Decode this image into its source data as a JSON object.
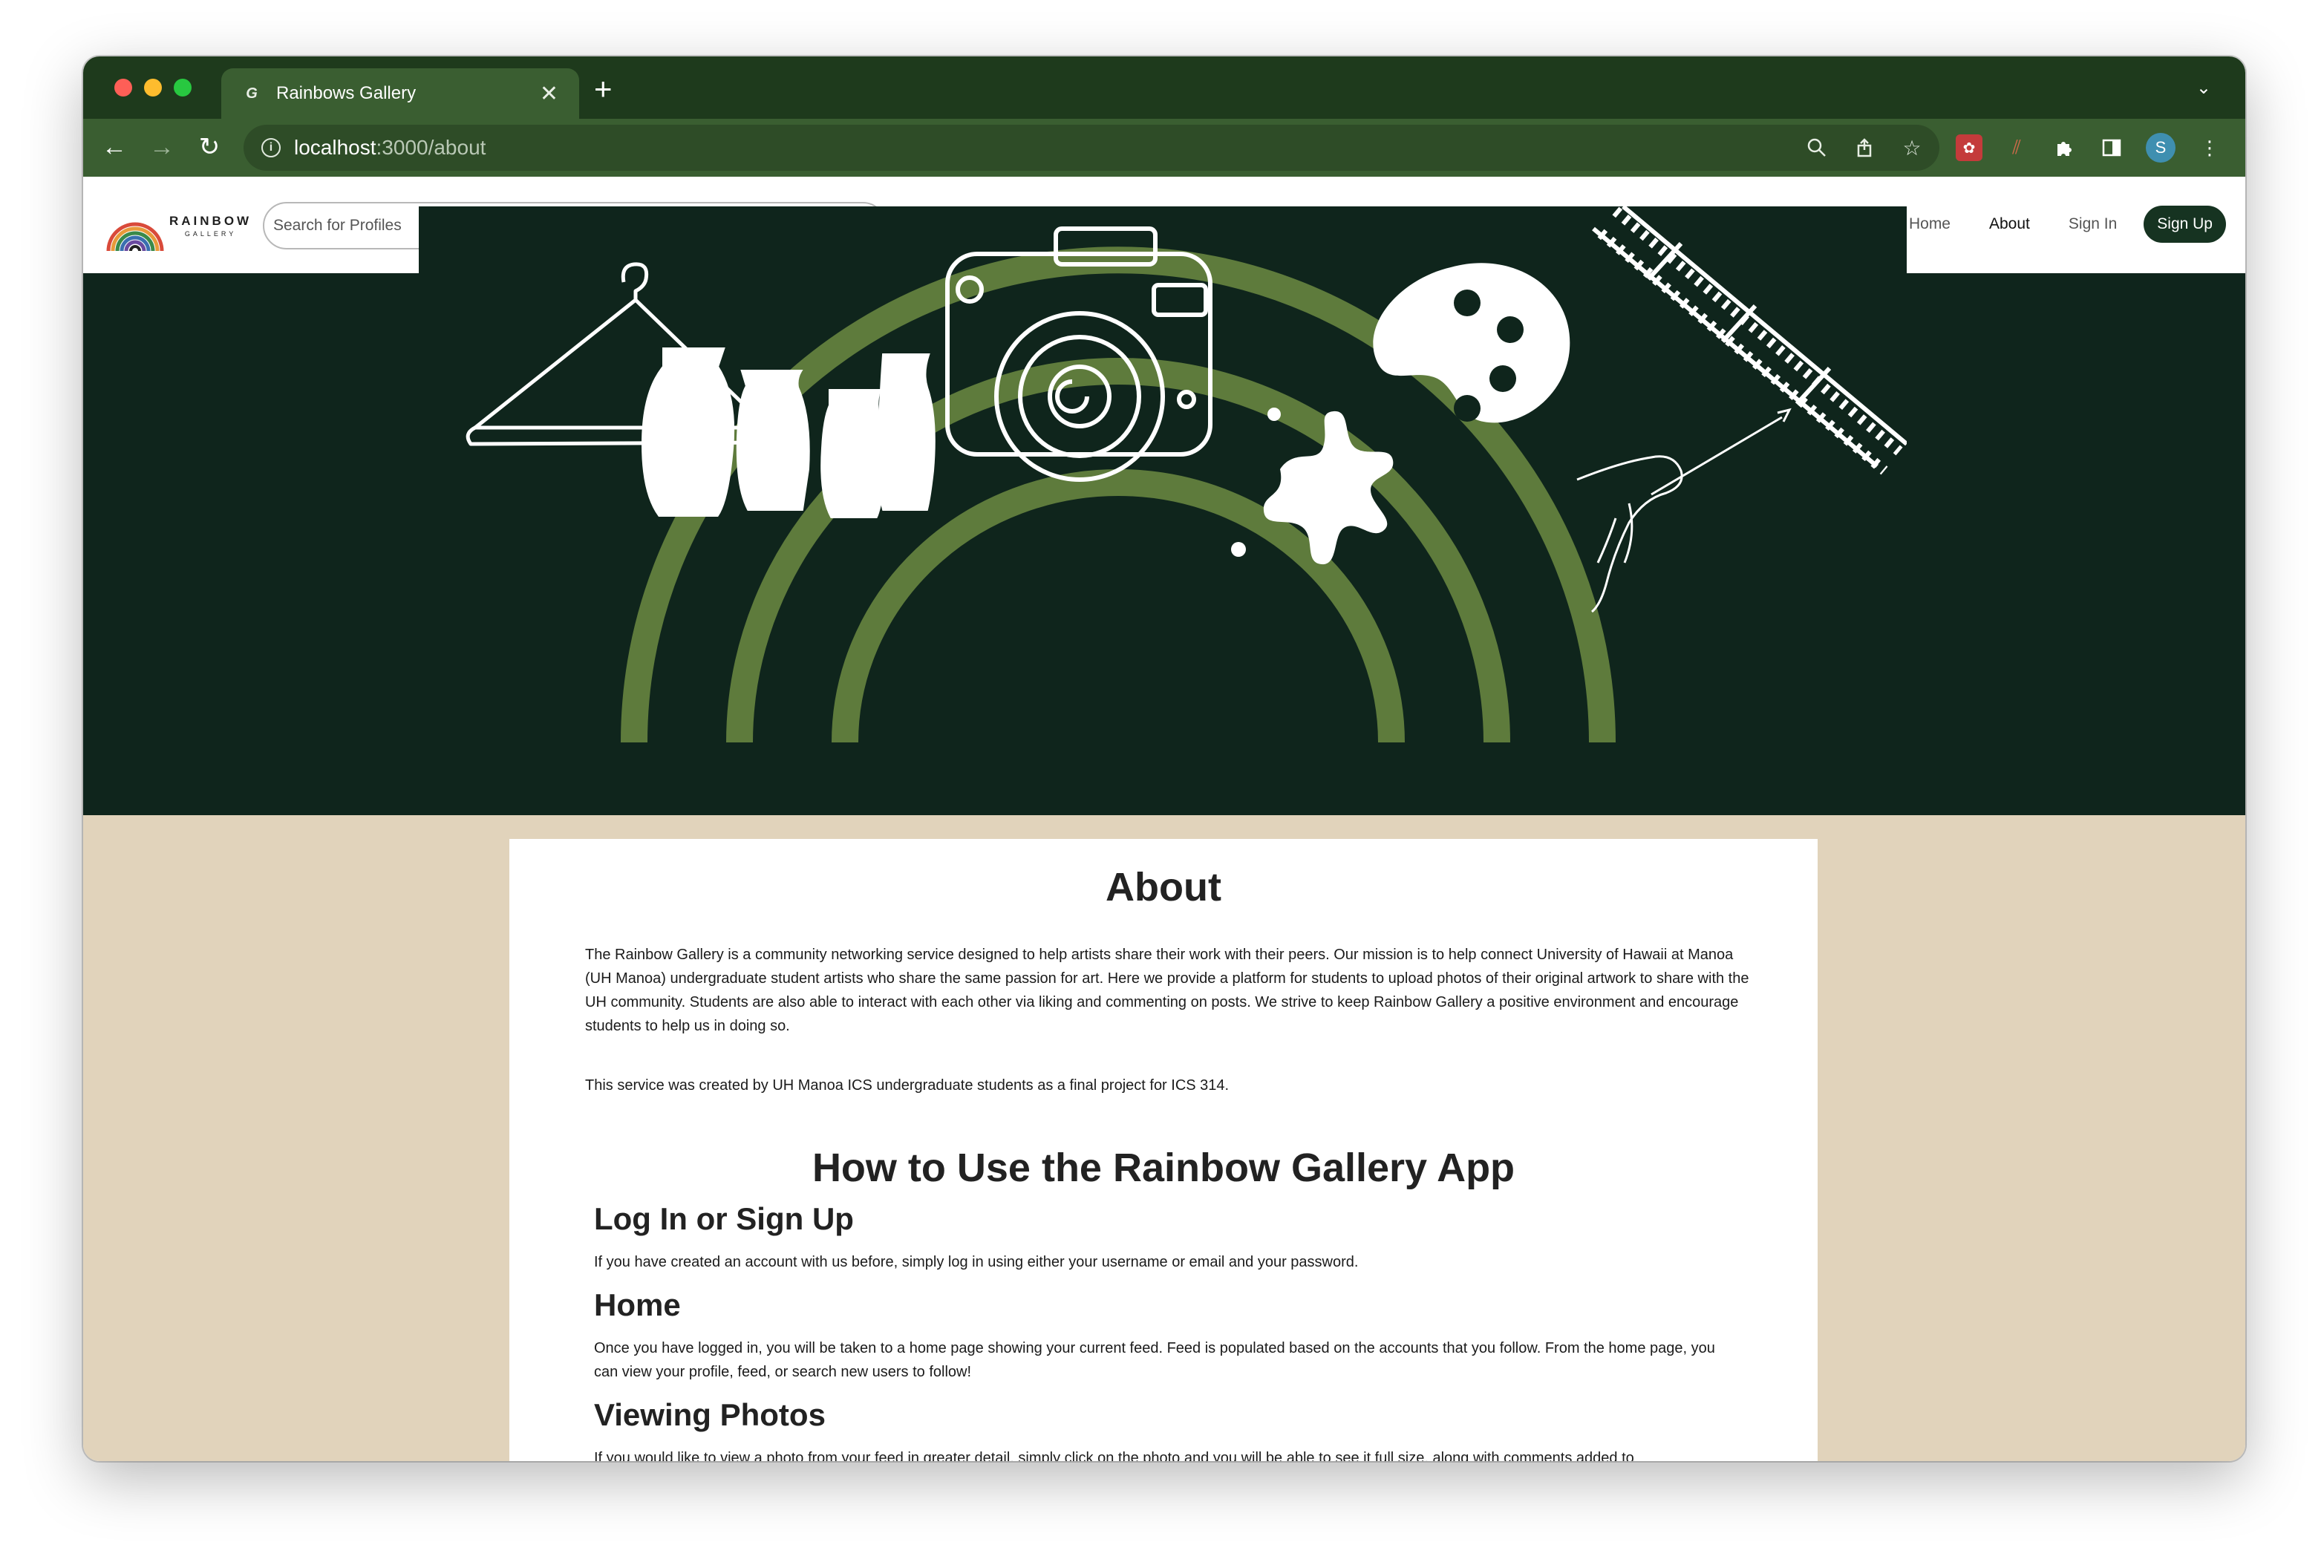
{
  "browser": {
    "tab_title": "Rainbows Gallery",
    "url_host": "localhost",
    "url_path": ":3000/about",
    "profile_initial": "S",
    "accent": "#3a5e31",
    "tabbar_color": "#1e3a1c"
  },
  "site": {
    "logo_main": "RAINBOW",
    "logo_sub": "GALLERY",
    "search_placeholder": "Search for Profiles",
    "nav": {
      "home": "Home",
      "about": "About",
      "sign_in": "Sign In",
      "sign_up": "Sign Up"
    },
    "hero_bg": "#0f251c",
    "rainbow_color": "#5e7b3c",
    "page_bg": "#e1d3bb"
  },
  "about": {
    "title": "About",
    "paragraph1": "The Rainbow Gallery is a community networking service designed to help artists share their work with their peers. Our mission is to help connect University of Hawaii at Manoa (UH Manoa) undergraduate student artists who share the same passion for art. Here we provide a platform for students to upload photos of their original artwork to share with the UH community. Students are also able to interact with each other via liking and commenting on posts. We strive to keep Rainbow Gallery a positive environment and encourage students to help us in doing so.",
    "paragraph2": "This service was created by UH Manoa ICS undergraduate students as a final project for ICS 314."
  },
  "howto": {
    "title": "How to Use the Rainbow Gallery App",
    "sections": [
      {
        "heading": "Log In or Sign Up",
        "text": "If you have created an account with us before, simply log in using either your username or email and your password."
      },
      {
        "heading": "Home",
        "text": "Once you have logged in, you will be taken to a home page showing your current feed. Feed is populated based on the accounts that you follow. From the home page, you can view your profile, feed, or search new users to follow!"
      },
      {
        "heading": "Viewing Photos",
        "text": "If you would like to view a photo from your feed in greater detail, simply click on the photo and you will be able to see it full size, along with comments added to"
      }
    ]
  }
}
